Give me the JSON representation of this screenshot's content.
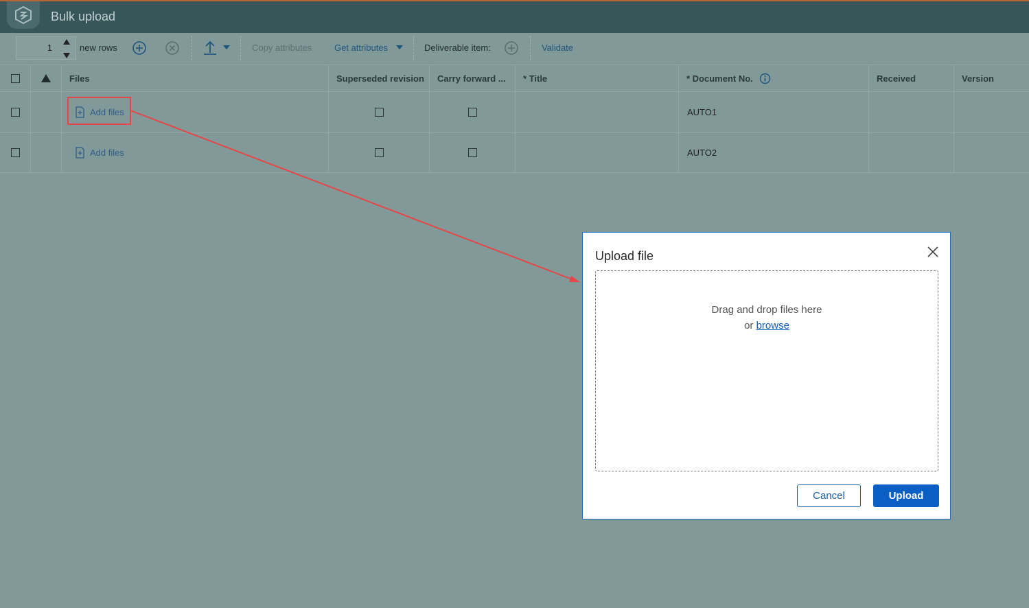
{
  "app": {
    "title": "Bulk upload"
  },
  "toolbar": {
    "rows_value": "1",
    "new_rows_label": "new rows",
    "copy_attributes_label": "Copy attributes",
    "get_attributes_label": "Get attributes",
    "deliverable_item_label": "Deliverable item:",
    "validate_label": "Validate"
  },
  "table": {
    "headers": {
      "files": "Files",
      "superseded_revision": "Superseded revision",
      "carry_forward": "Carry forward ...",
      "title": "* Title",
      "document_no": "* Document No.",
      "received": "Received",
      "version": "Version"
    },
    "rows": [
      {
        "add_files": "Add files",
        "document_no": "AUTO1"
      },
      {
        "add_files": "Add files",
        "document_no": "AUTO2"
      }
    ]
  },
  "modal": {
    "title": "Upload file",
    "drop_text": "Drag and drop files here",
    "or_text": "or",
    "browse_link": "browse",
    "cancel_label": "Cancel",
    "upload_label": "Upload"
  },
  "colors": {
    "title_bar": "#365659",
    "overlay": "#82999a",
    "highlight": "#e64646",
    "primary": "#0a5fc4"
  }
}
